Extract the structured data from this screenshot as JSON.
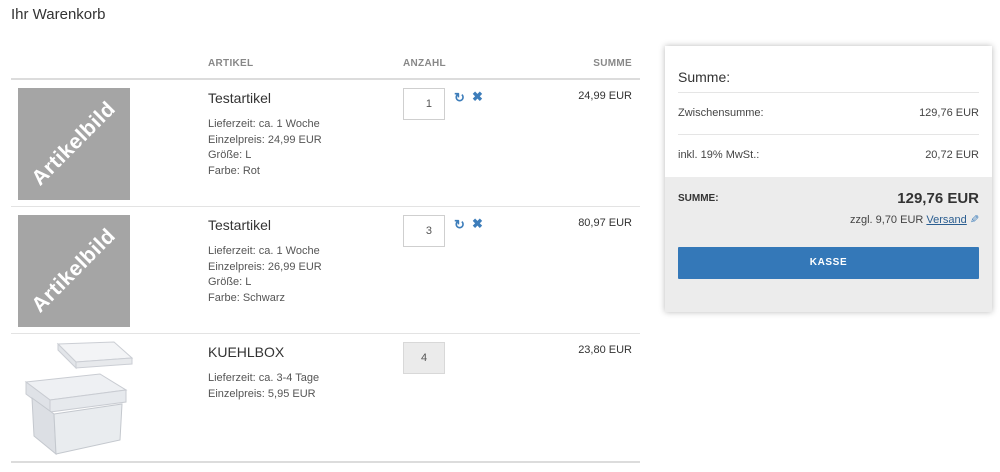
{
  "page_title": "Ihr Warenkorb",
  "table_header": {
    "artikel": "ARTIKEL",
    "anzahl": "ANZAHL",
    "summe": "SUMME"
  },
  "placeholder_image_text": "Artikelbild",
  "items": [
    {
      "name": "Testartikel",
      "details": [
        "Lieferzeit: ca. 1 Woche",
        "Einzelpreis: 24,99 EUR",
        "Größe: L",
        "Farbe: Rot"
      ],
      "quantity": "1",
      "editable": true,
      "total": "24,99 EUR",
      "image": "placeholder"
    },
    {
      "name": "Testartikel",
      "details": [
        "Lieferzeit: ca. 1 Woche",
        "Einzelpreis: 26,99 EUR",
        "Größe: L",
        "Farbe: Schwarz"
      ],
      "quantity": "3",
      "editable": true,
      "total": "80,97 EUR",
      "image": "placeholder"
    },
    {
      "name": "KUEHLBOX",
      "details": [
        "Lieferzeit: ca. 3-4 Tage",
        "Einzelpreis: 5,95 EUR"
      ],
      "quantity": "4",
      "editable": false,
      "total": "23,80 EUR",
      "image": "styrofoam-box"
    }
  ],
  "icons": {
    "refresh": "refresh-icon",
    "remove": "remove-icon",
    "edit": "pencil-icon"
  },
  "summary": {
    "heading": "Summe:",
    "subtotal_label": "Zwischensumme:",
    "subtotal_value": "129,76 EUR",
    "tax_label": "inkl. 19% MwSt.:",
    "tax_value": "20,72 EUR",
    "total_label": "SUMME:",
    "total_value": "129,76 EUR",
    "shipping_prefix": "zzgl. 9,70 EUR",
    "shipping_link": "Versand",
    "checkout_label": "KASSE"
  },
  "colors": {
    "accent": "#3478b8",
    "link": "#2b5e91",
    "placeholder": "#a5a5a5",
    "total_bg": "#ececec"
  }
}
